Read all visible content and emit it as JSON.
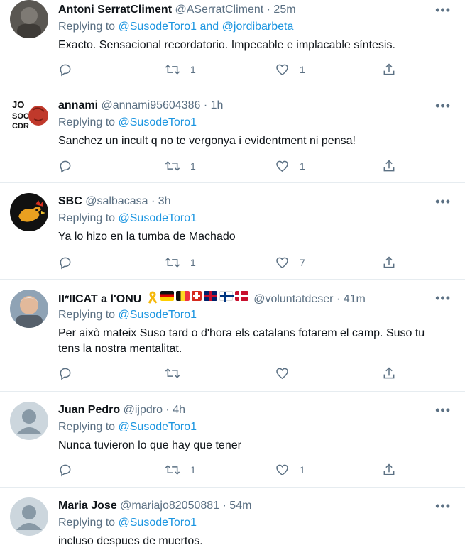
{
  "tweets": [
    {
      "name": "Antoni SerratCliment",
      "handle": "@ASerratCliment",
      "time": "25m",
      "replying_prefix": "Replying to",
      "replying_a": "@SusodeToro1",
      "replying_join": "and",
      "replying_b": "@jordibarbeta",
      "text": "Exacto. Sensacional recordatorio. Impecable e implacable síntesis.",
      "replies": "",
      "retweets": "1",
      "likes": "1"
    },
    {
      "name": "annami",
      "handle": "@annami95604386",
      "time": "1h",
      "replying_prefix": "Replying to",
      "replying_a": "@SusodeToro1",
      "text": "Sanchez un incult q no te vergonya i evidentment ni pensa!",
      "avatar_lines": [
        "JO",
        "SOC",
        "CDR"
      ],
      "replies": "",
      "retweets": "1",
      "likes": "1"
    },
    {
      "name": "SBC",
      "handle": "@salbacasa",
      "time": "3h",
      "replying_prefix": "Replying to",
      "replying_a": "@SusodeToro1",
      "text": "Ya lo hizo en la tumba de Machado",
      "replies": "",
      "retweets": "1",
      "likes": "7"
    },
    {
      "name": "II*IICAT a l'ONU",
      "handle": "@voluntatdeser",
      "time": "41m",
      "replying_prefix": "Replying to",
      "replying_a": "@SusodeToro1",
      "text": "Per això mateix Suso tard o d'hora els catalans fotarem el camp. Suso tu tens la nostra mentalitat.",
      "replies": "",
      "retweets": "",
      "likes": ""
    },
    {
      "name": "Juan Pedro",
      "handle": "@ijpdro",
      "time": "4h",
      "replying_prefix": "Replying to",
      "replying_a": "@SusodeToro1",
      "text": "Nunca tuvieron lo que hay que tener",
      "replies": "",
      "retweets": "1",
      "likes": "1"
    },
    {
      "name": "Maria Jose",
      "handle": "@mariajo82050881",
      "time": "54m",
      "replying_prefix": "Replying to",
      "replying_a": "@SusodeToro1",
      "text": "incluso despues de muertos."
    }
  ],
  "colors": {
    "link": "#1b95e0",
    "muted": "#5b7083",
    "text": "#0f1419"
  },
  "icons": [
    "more-icon",
    "reply-icon",
    "retweet-icon",
    "like-icon",
    "share-icon",
    "yellow-ribbon-icon"
  ]
}
